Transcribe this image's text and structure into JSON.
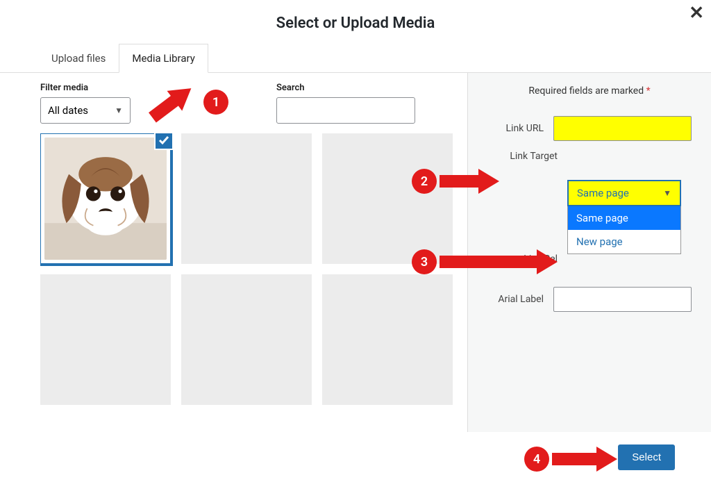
{
  "modal": {
    "title": "Select or Upload Media",
    "close_icon": "✕"
  },
  "tabs": {
    "upload": "Upload files",
    "library": "Media Library"
  },
  "filters": {
    "filter_label": "Filter media",
    "date_value": "All dates",
    "search_label": "Search",
    "search_value": ""
  },
  "grid": {
    "items": [
      {
        "selected": true,
        "alt": "dog-photo"
      },
      {
        "selected": false
      },
      {
        "selected": false
      },
      {
        "selected": false
      },
      {
        "selected": false
      },
      {
        "selected": false
      }
    ]
  },
  "sidebar": {
    "required_note": "Required fields are marked",
    "required_star": "*",
    "link_url_label": "Link URL",
    "link_url_value": "",
    "link_target_label": "Link Target",
    "link_target_value": "Same page",
    "link_target_options": [
      "Same page",
      "New page"
    ],
    "link_rel_label": "Link Rel",
    "link_rel_value": "",
    "aria_label_label": "Arial Label",
    "aria_label_value": ""
  },
  "footer": {
    "select_label": "Select"
  },
  "callouts": {
    "c1": "1",
    "c2": "2",
    "c3": "3",
    "c4": "4"
  },
  "colors": {
    "accent": "#2271b1",
    "highlight": "#ffff00",
    "callout": "#e21b1b"
  }
}
